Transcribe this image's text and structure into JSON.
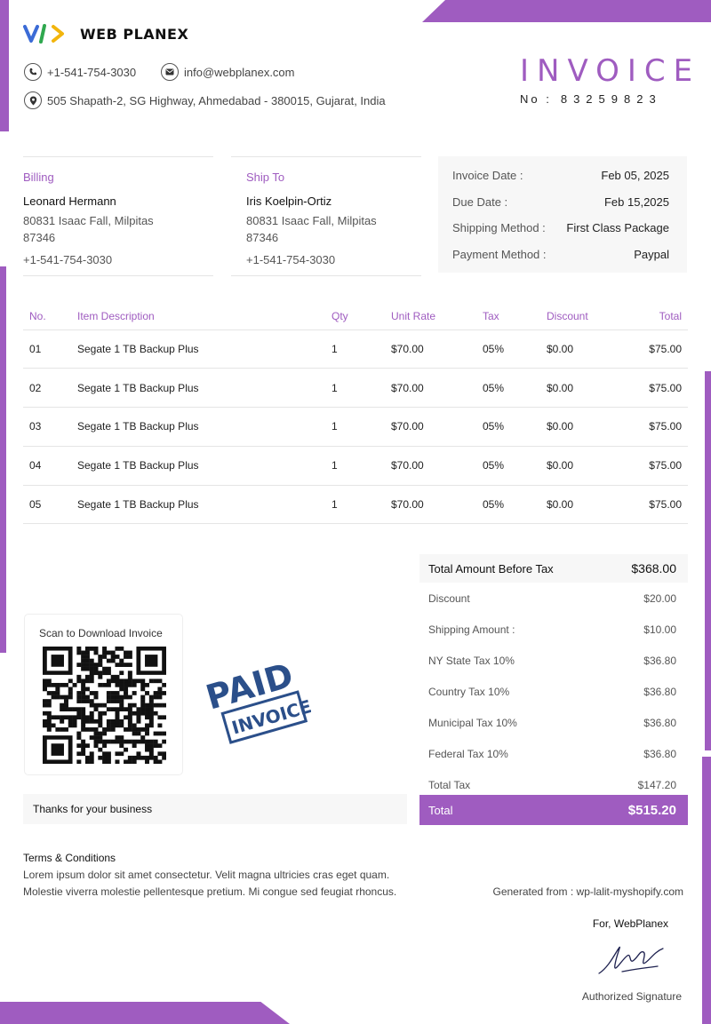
{
  "company": {
    "name": "WEB PLANEX",
    "phone": "+1-541-754-3030",
    "email": "info@webplanex.com",
    "address": "505 Shapath-2, SG Highway, Ahmedabad - 380015, Gujarat, India"
  },
  "invoice": {
    "title": "INVOICE",
    "number_label": "No :",
    "number": "83259823"
  },
  "billing": {
    "label": "Billing",
    "name": "Leonard Hermann",
    "address_line1": "80831 Isaac Fall, Milpitas",
    "address_line2": "87346",
    "phone": "+1-541-754-3030"
  },
  "ship_to": {
    "label": "Ship To",
    "name": "Iris Koelpin-Ortiz",
    "address_line1": "80831 Isaac Fall, Milpitas",
    "address_line2": "87346",
    "phone": "+1-541-754-3030"
  },
  "meta": [
    {
      "label": "Invoice Date :",
      "value": "Feb 05, 2025"
    },
    {
      "label": "Due Date :",
      "value": "Feb 15,2025"
    },
    {
      "label": "Shipping Method :",
      "value": "First Class Package"
    },
    {
      "label": "Payment Method :",
      "value": "Paypal"
    }
  ],
  "table": {
    "headers": [
      "No.",
      "Item Description",
      "Qty",
      "Unit Rate",
      "Tax",
      "Discount",
      "Total"
    ],
    "rows": [
      [
        "01",
        "Segate 1 TB Backup Plus",
        "1",
        "$70.00",
        "05%",
        "$0.00",
        "$75.00"
      ],
      [
        "02",
        "Segate 1 TB Backup Plus",
        "1",
        "$70.00",
        "05%",
        "$0.00",
        "$75.00"
      ],
      [
        "03",
        "Segate 1 TB Backup Plus",
        "1",
        "$70.00",
        "05%",
        "$0.00",
        "$75.00"
      ],
      [
        "04",
        "Segate 1 TB Backup Plus",
        "1",
        "$70.00",
        "05%",
        "$0.00",
        "$75.00"
      ],
      [
        "05",
        "Segate 1 TB Backup Plus",
        "1",
        "$70.00",
        "05%",
        "$0.00",
        "$75.00"
      ]
    ]
  },
  "summary": {
    "before_tax_label": "Total Amount Before Tax",
    "before_tax_value": "$368.00",
    "rows": [
      {
        "label": "Discount",
        "value": "$20.00"
      },
      {
        "label": "Shipping Amount :",
        "value": "$10.00"
      },
      {
        "label": "NY State Tax 10%",
        "value": "$36.80"
      },
      {
        "label": "Country Tax 10%",
        "value": "$36.80"
      },
      {
        "label": "Municipal Tax 10%",
        "value": "$36.80"
      },
      {
        "label": "Federal Tax 10%",
        "value": "$36.80"
      },
      {
        "label": "Total Tax",
        "value": "$147.20"
      }
    ],
    "total_label": "Total",
    "total_value": "$515.20"
  },
  "qr": {
    "caption": "Scan to Download Invoice"
  },
  "stamp": {
    "line1": "PAID",
    "line2": "INVOICE",
    "color": "#2b4f8a"
  },
  "thanks": "Thanks for your business",
  "terms": {
    "title": "Terms & Conditions",
    "line1": "Lorem ipsum dolor sit amet consectetur. Velit magna ultricies cras eget quam.",
    "line2": "Molestie viverra molestie pellentesque pretium. Mi congue sed feugiat rhoncus."
  },
  "generated": "Generated from : wp-lalit-myshopify.com",
  "signature": {
    "for": "For, WebPlanex",
    "label": "Authorized Signature"
  },
  "colors": {
    "accent": "#9f5cc0",
    "panel": "#f7f7f7"
  }
}
